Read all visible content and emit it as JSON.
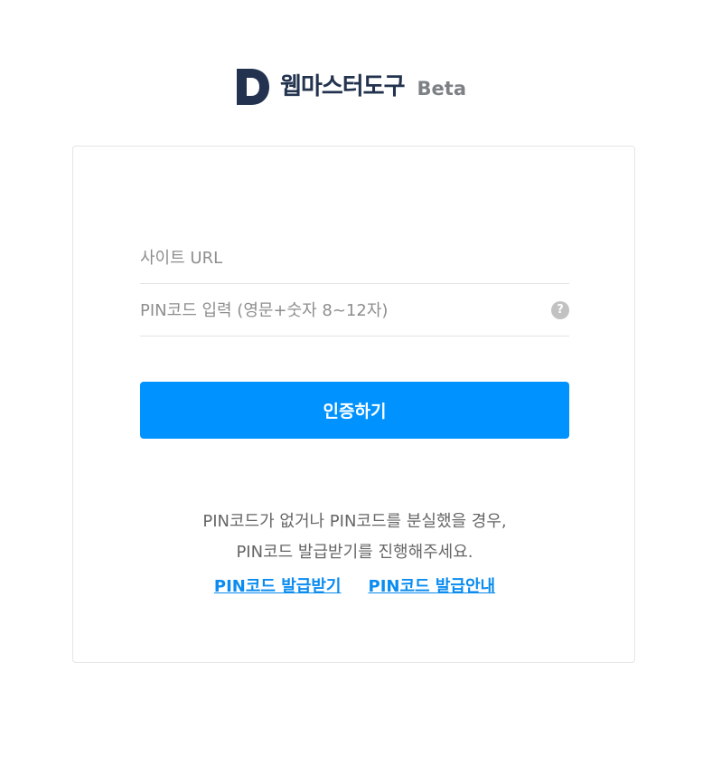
{
  "brand": {
    "logo_icon": "d-logo-icon",
    "name": "웹마스터도구",
    "badge": "Beta",
    "color_primary": "#23334f",
    "color_badge": "#7d8186"
  },
  "form": {
    "url_placeholder": "사이트 URL",
    "pin_placeholder": "PIN코드 입력 (영문+숫자 8~12자)",
    "help_icon": "question-circle-icon",
    "help_glyph": "?",
    "submit_label": "인증하기",
    "submit_color": "#0092ff"
  },
  "notice": {
    "line1": "PIN코드가 없거나 PIN코드를 분실했을 경우,",
    "line2": "PIN코드 발급받기를 진행해주세요."
  },
  "links": {
    "issue_label": "PIN코드 발급받기",
    "guide_label": "PIN코드 발급안내",
    "color": "#0a8cf0"
  }
}
